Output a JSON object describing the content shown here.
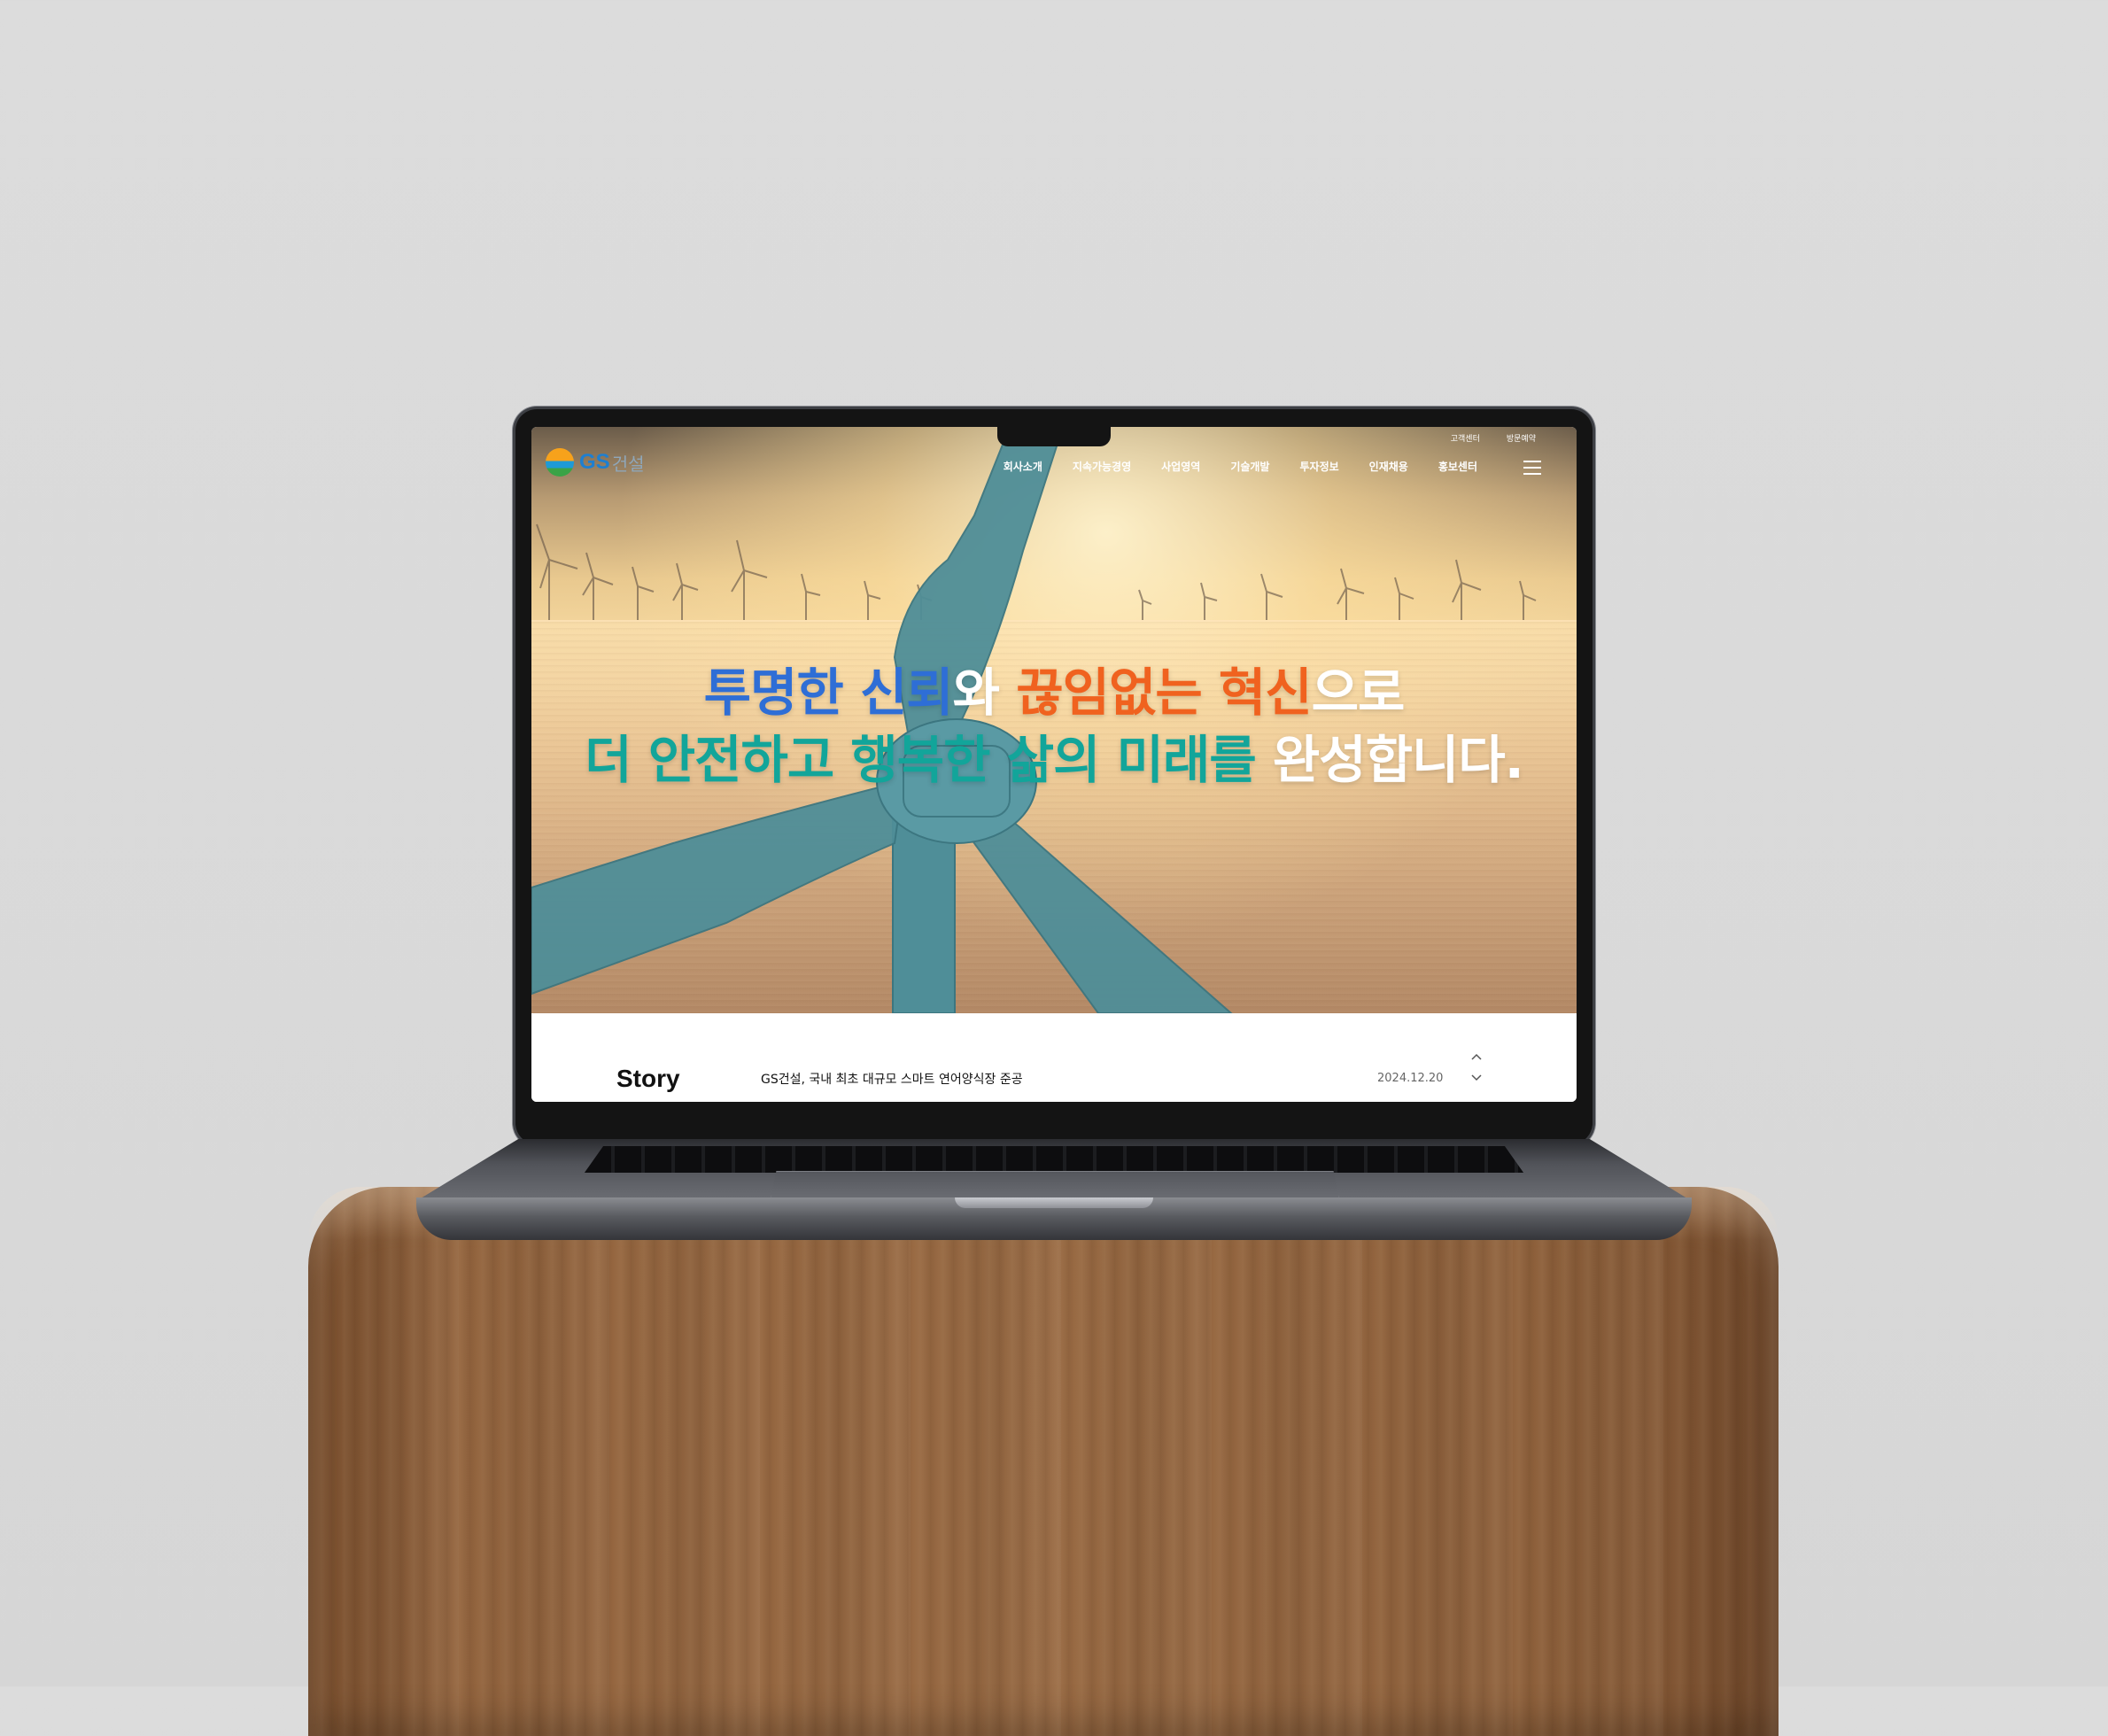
{
  "header": {
    "logo": {
      "brand": "GS",
      "name": "건설"
    },
    "utility_links": [
      "고객센터",
      "방문예약"
    ],
    "nav_items": [
      "회사소개",
      "지속가능경영",
      "사업영역",
      "기술개발",
      "투자정보",
      "인재채용",
      "홍보센터"
    ],
    "menu_icon": "hamburger-icon"
  },
  "hero": {
    "line1": [
      {
        "text": "투명한 신뢰",
        "color": "#2e6ed6"
      },
      {
        "text": "와 ",
        "color": "#ffffff"
      },
      {
        "text": "끊임없는 혁신",
        "color": "#f0621f"
      },
      {
        "text": "으로",
        "color": "#ffffff"
      }
    ],
    "line2": [
      {
        "text": "더 안전하고 행복한 삶의 미래를 ",
        "color": "#12a59a"
      },
      {
        "text": "완성합니다.",
        "color": "#ffffff"
      }
    ]
  },
  "story": {
    "label": "Story",
    "title": "GS건설, 국내 최초 대규모 스마트 연어양식장 준공",
    "date": "2024.12.20",
    "prev_icon": "chevron-up-icon",
    "next_icon": "chevron-down-icon"
  }
}
